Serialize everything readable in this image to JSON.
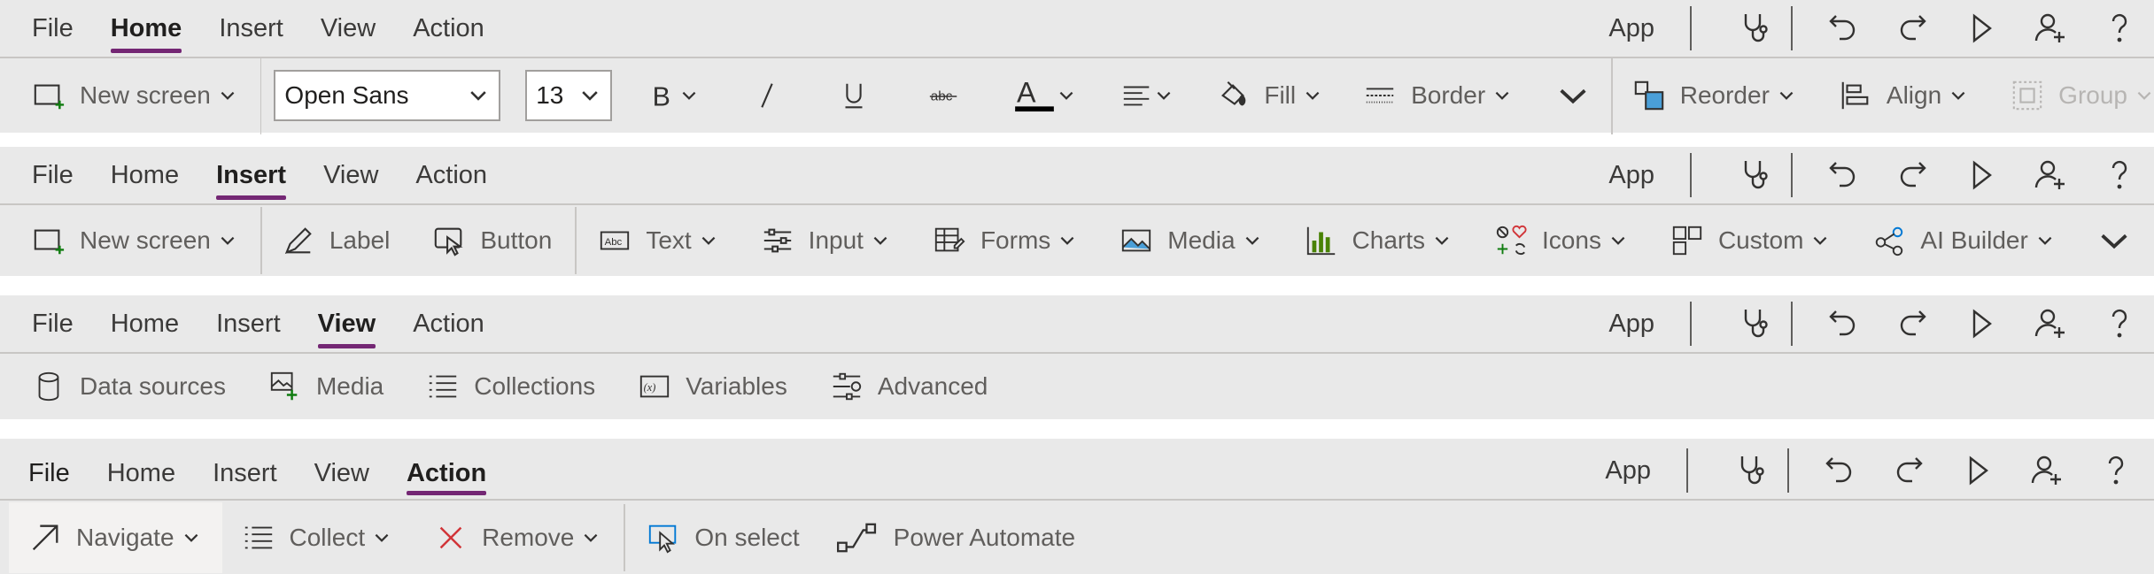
{
  "common": {
    "tabs": [
      "File",
      "Home",
      "Insert",
      "View",
      "Action"
    ],
    "app_label": "App",
    "right_icons": [
      "stethoscope-icon",
      "undo-icon",
      "redo-icon",
      "play-icon",
      "add-user-icon",
      "help-icon"
    ]
  },
  "home": {
    "active_tab": "Home",
    "new_screen": "New screen",
    "font_name": "Open Sans",
    "font_size": "13",
    "fill": "Fill",
    "border": "Border",
    "reorder": "Reorder",
    "align": "Align",
    "group": "Group",
    "font_color_bar": "#000000"
  },
  "insert": {
    "active_tab": "Insert",
    "new_screen": "New screen",
    "label": "Label",
    "button": "Button",
    "text": "Text",
    "input": "Input",
    "forms": "Forms",
    "media": "Media",
    "charts": "Charts",
    "icons": "Icons",
    "custom": "Custom",
    "ai_builder": "AI Builder"
  },
  "view": {
    "active_tab": "View",
    "data_sources": "Data sources",
    "media": "Media",
    "collections": "Collections",
    "variables": "Variables",
    "advanced": "Advanced"
  },
  "action": {
    "active_tab": "Action",
    "navigate": "Navigate",
    "collect": "Collect",
    "remove": "Remove",
    "on_select": "On select",
    "power_automate": "Power Automate"
  },
  "colors": {
    "accent": "#742774",
    "panel_bg": "#e9e9e9",
    "add_green": "#107c10",
    "remove_red": "#d13438",
    "chart_green": "#498205"
  }
}
